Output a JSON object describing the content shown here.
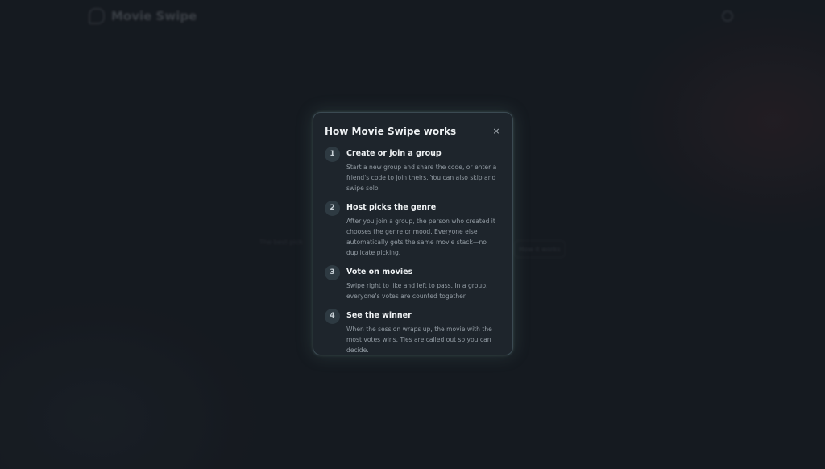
{
  "app": {
    "name": "Movie Swipe"
  },
  "background": {
    "left_text": "The best pick",
    "right_button": "How it works"
  },
  "modal": {
    "title": "How Movie Swipe works",
    "close_label": "×",
    "steps": [
      {
        "number": "1",
        "title": "Create or join a group",
        "description": "Start a new group and share the code, or enter a friend's code to join theirs. You can also skip and swipe solo."
      },
      {
        "number": "2",
        "title": "Host picks the genre",
        "description": "After you join a group, the person who created it chooses the genre or mood. Everyone else automatically gets the same movie stack—no duplicate picking."
      },
      {
        "number": "3",
        "title": "Vote on movies",
        "description": "Swipe right to like and left to pass. In a group, everyone's votes are counted together."
      },
      {
        "number": "4",
        "title": "See the winner",
        "description": "When the session wraps up, the movie with the most votes wins. Ties are called out so you can decide."
      }
    ]
  },
  "icons": {
    "logo": "movie-swipe-logo-icon",
    "top_right": "settings-icon",
    "close": "close-icon"
  },
  "colors": {
    "background": "#1a1f25",
    "modal_bg": "#1e252c",
    "modal_border": "#3b4a52",
    "text_primary": "#eef1f3",
    "text_secondary": "#939ca4",
    "badge_bg": "#2e3a42"
  }
}
